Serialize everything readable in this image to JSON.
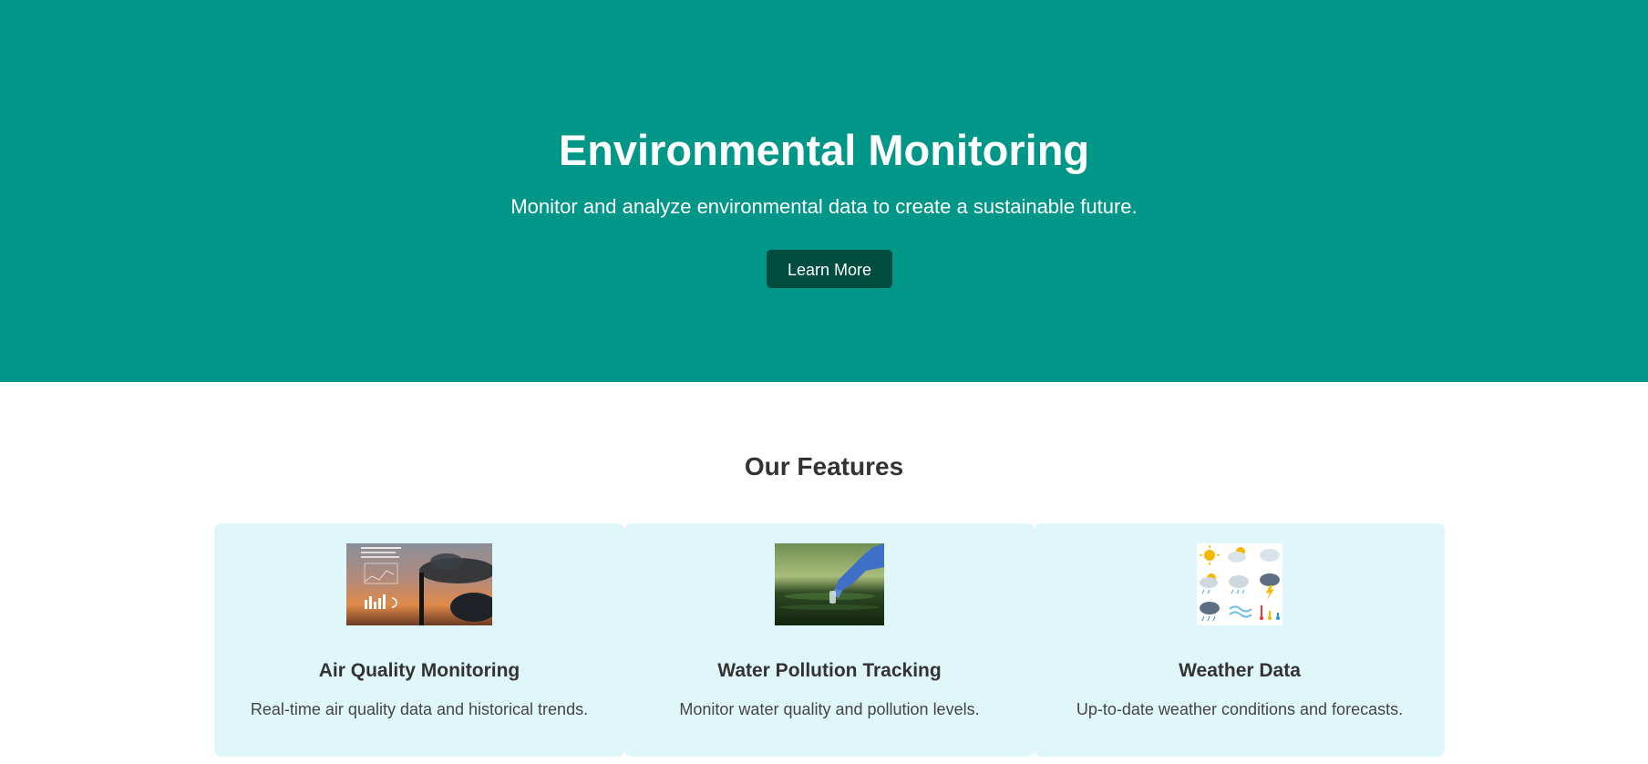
{
  "hero": {
    "title": "Environmental Monitoring",
    "subtitle": "Monitor and analyze environmental data to create a sustainable future.",
    "button_label": "Learn More",
    "background_color": "#009688",
    "button_color": "#004d40"
  },
  "features": {
    "title": "Our Features",
    "card_color": "#e0f7fa",
    "items": [
      {
        "title": "Air Quality Monitoring",
        "description": "Real-time air quality data and historical trends.",
        "image": "factory-smokestack-sunset-image"
      },
      {
        "title": "Water Pollution Tracking",
        "description": "Monitor water quality and pollution levels.",
        "image": "gloved-hand-water-sample-image"
      },
      {
        "title": "Weather Data",
        "description": "Up-to-date weather conditions and forecasts.",
        "image": "weather-icons-grid-image"
      }
    ]
  }
}
